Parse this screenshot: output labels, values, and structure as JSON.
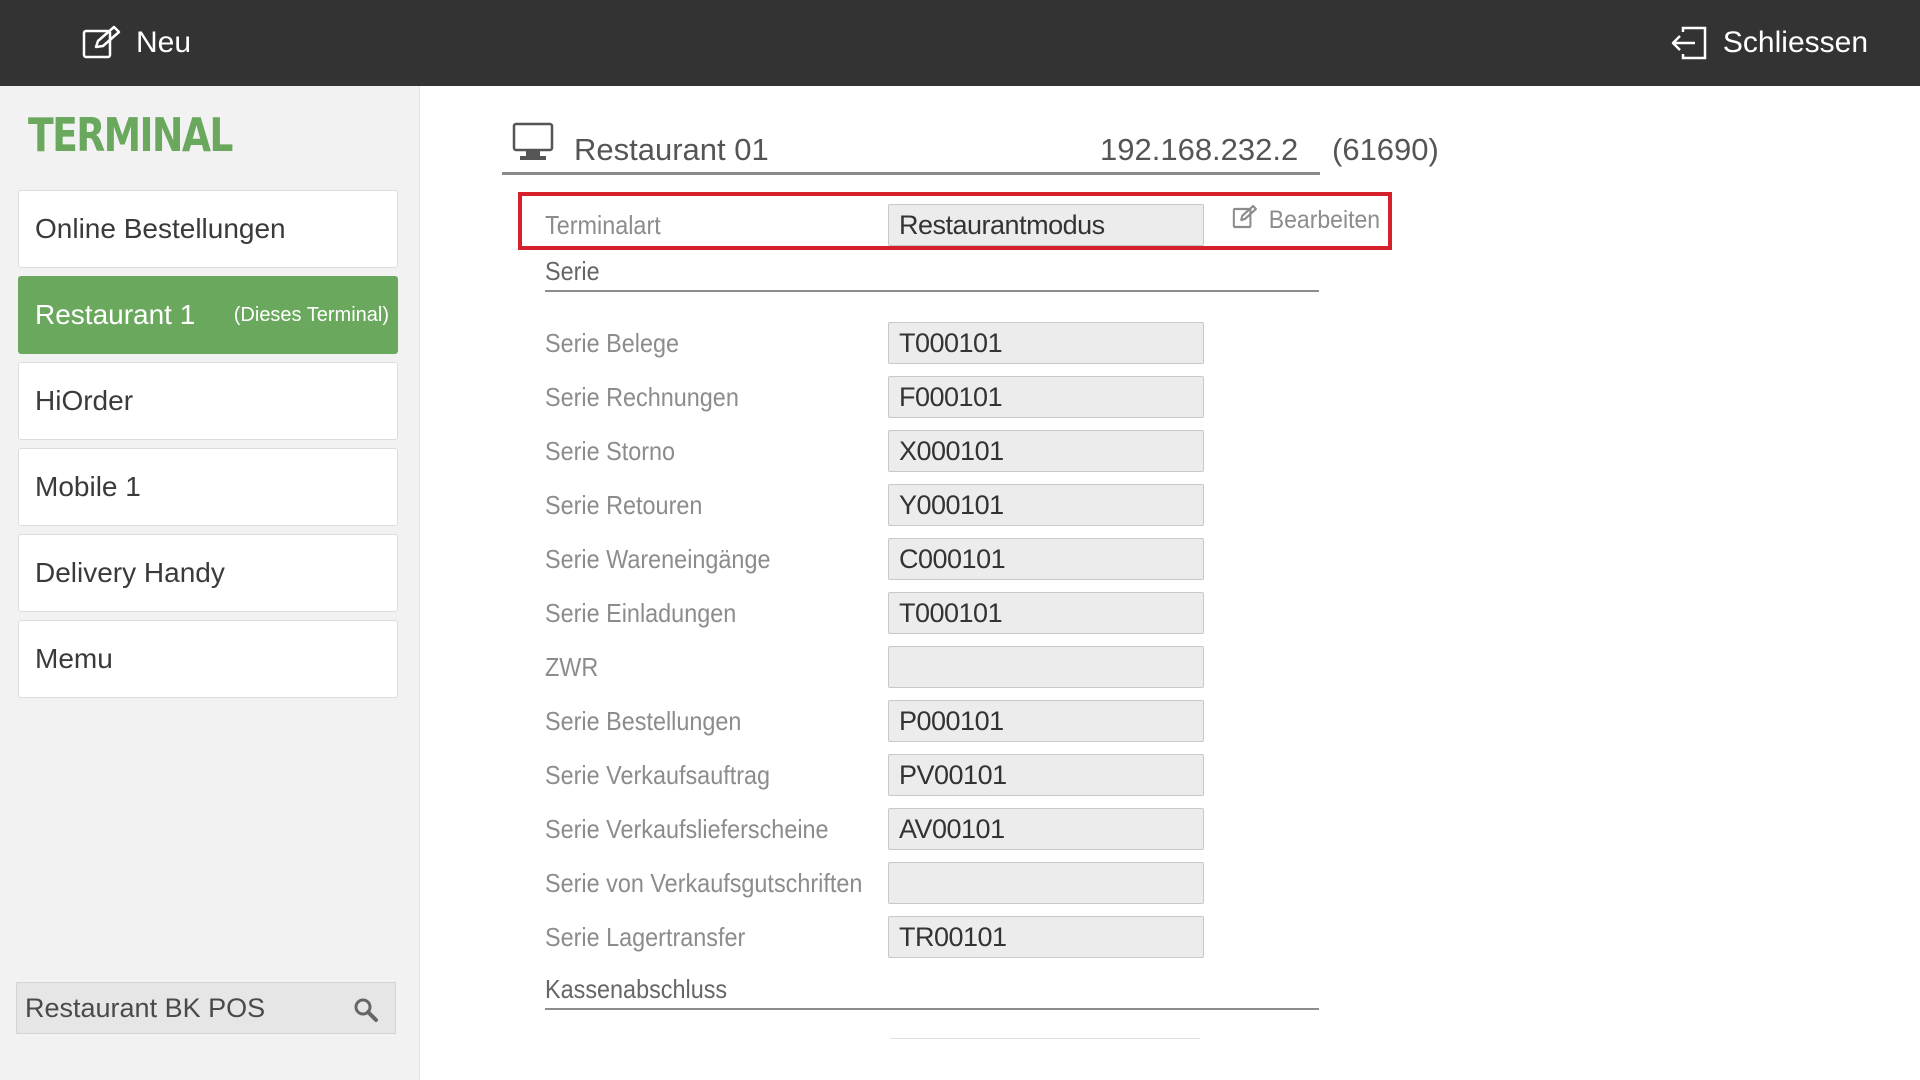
{
  "topbar": {
    "new_label": "Neu",
    "close_label": "Schliessen"
  },
  "sidebar": {
    "title": "TERMINAL",
    "items": [
      {
        "label": "Online Bestellungen",
        "sub": ""
      },
      {
        "label": "Restaurant 1",
        "sub": "(Dieses Terminal)",
        "active": true
      },
      {
        "label": "HiOrder",
        "sub": ""
      },
      {
        "label": "Mobile 1",
        "sub": ""
      },
      {
        "label": "Delivery Handy",
        "sub": ""
      },
      {
        "label": "Memu",
        "sub": ""
      }
    ],
    "search_value": "Restaurant BK POS"
  },
  "terminal": {
    "name": "Restaurant 01",
    "ip": "192.168.232.2",
    "port": "(61690)"
  },
  "terminalart": {
    "label": "Terminalart",
    "value": "Restaurantmodus",
    "edit_label": "Bearbeiten"
  },
  "sections": {
    "serie": "Serie",
    "kassenabschluss": "Kassenabschluss"
  },
  "serie_rows": [
    {
      "label": "Serie Belege",
      "value": "T000101"
    },
    {
      "label": "Serie Rechnungen",
      "value": "F000101"
    },
    {
      "label": "Serie Storno",
      "value": "X000101"
    },
    {
      "label": "Serie Retouren",
      "value": "Y000101"
    },
    {
      "label": "Serie Wareneingänge",
      "value": "C000101"
    },
    {
      "label": "Serie Einladungen",
      "value": "T000101"
    },
    {
      "label": "ZWR",
      "value": ""
    },
    {
      "label": "Serie Bestellungen",
      "value": "P000101"
    },
    {
      "label": "Serie Verkaufsauftrag",
      "value": "PV00101"
    },
    {
      "label": "Serie Verkaufslieferscheine",
      "value": "AV00101"
    },
    {
      "label": "Serie von Verkaufsgutschriften",
      "value": ""
    },
    {
      "label": "Serie Lagertransfer",
      "value": "TR00101"
    }
  ],
  "colors": {
    "topbar": "#333333",
    "accent_green": "#6aa85e",
    "highlight_red": "#d6202c"
  }
}
